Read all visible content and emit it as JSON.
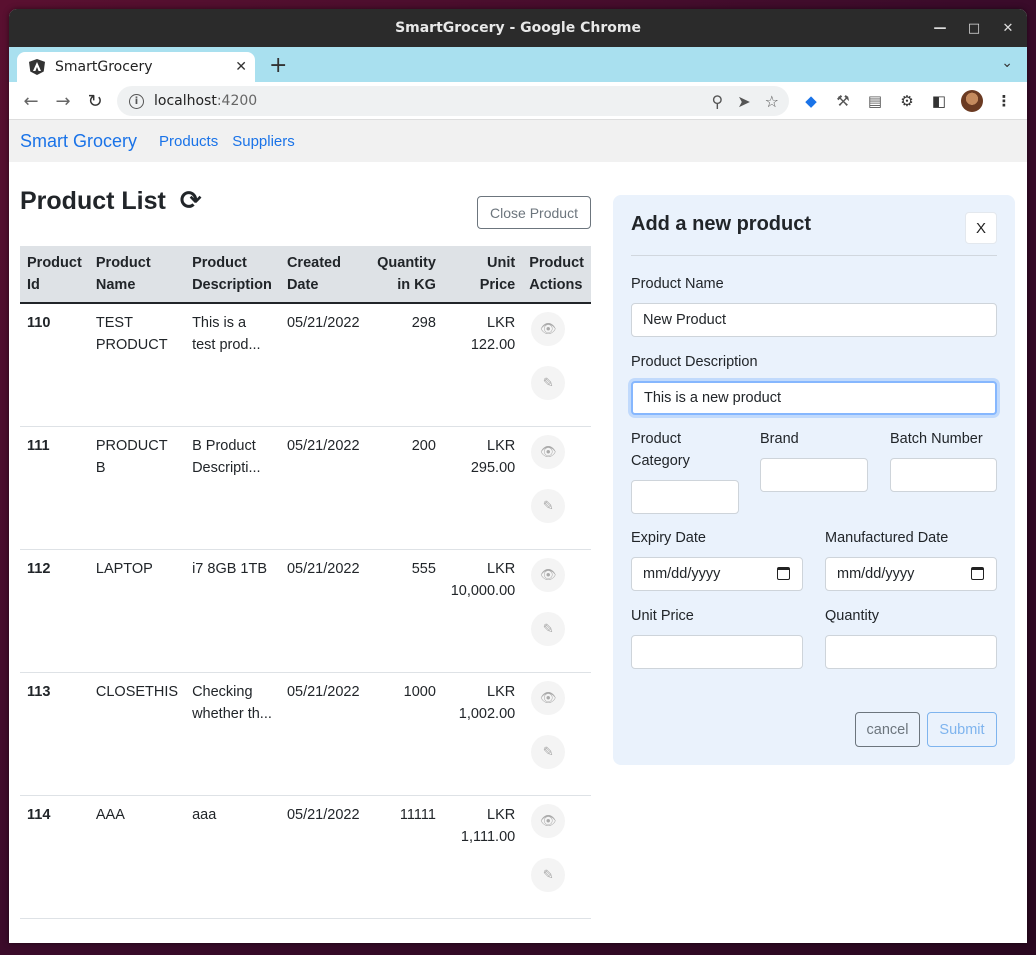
{
  "window": {
    "title": "SmartGrocery - Google Chrome"
  },
  "browser": {
    "tab_title": "SmartGrocery",
    "url_host": "localhost",
    "url_port": ":4200"
  },
  "app": {
    "brand": "Smart Grocery",
    "nav": [
      "Products",
      "Suppliers"
    ]
  },
  "product_list": {
    "title": "Product List",
    "close_button": "Close Product",
    "headers": [
      [
        "Product",
        "Id"
      ],
      [
        "Product",
        "Name"
      ],
      [
        "Product",
        "Description"
      ],
      [
        "Created",
        "Date"
      ],
      [
        "Quantity",
        "in KG"
      ],
      [
        "Unit",
        "Price"
      ],
      [
        "Product",
        "Actions"
      ]
    ],
    "rows": [
      {
        "id": "110",
        "name": "TEST PRODUCT",
        "description": "This is a test prod...",
        "created": "05/21/2022",
        "quantity": "298",
        "currency": "LKR",
        "price": "122.00"
      },
      {
        "id": "111",
        "name": "PRODUCT B",
        "description": "B Product Descripti...",
        "created": "05/21/2022",
        "quantity": "200",
        "currency": "LKR",
        "price": "295.00"
      },
      {
        "id": "112",
        "name": "LAPTOP",
        "description": "i7 8GB 1TB",
        "created": "05/21/2022",
        "quantity": "555",
        "currency": "LKR",
        "price": "10,000.00"
      },
      {
        "id": "113",
        "name": "CLOSETHIS",
        "description": "Checking whether th...",
        "created": "05/21/2022",
        "quantity": "1000",
        "currency": "LKR",
        "price": "1,002.00"
      },
      {
        "id": "114",
        "name": "AAA",
        "description": "aaa",
        "created": "05/21/2022",
        "quantity": "11111",
        "currency": "LKR",
        "price": "1,111.00"
      }
    ]
  },
  "form": {
    "title": "Add a new product",
    "close_label": "X",
    "name_label": "Product Name",
    "name_value": "New Product",
    "description_label": "Product Description",
    "description_value": "This is a new product",
    "category_label": "Product Category",
    "brand_label": "Brand",
    "batch_label": "Batch Number",
    "expiry_label": "Expiry Date",
    "expiry_placeholder": "mm/dd/yyyy",
    "manufactured_label": "Manufactured Date",
    "manufactured_placeholder": "mm/dd/yyyy",
    "unit_price_label": "Unit Price",
    "quantity_label": "Quantity",
    "cancel_label": "cancel",
    "submit_label": "Submit"
  }
}
